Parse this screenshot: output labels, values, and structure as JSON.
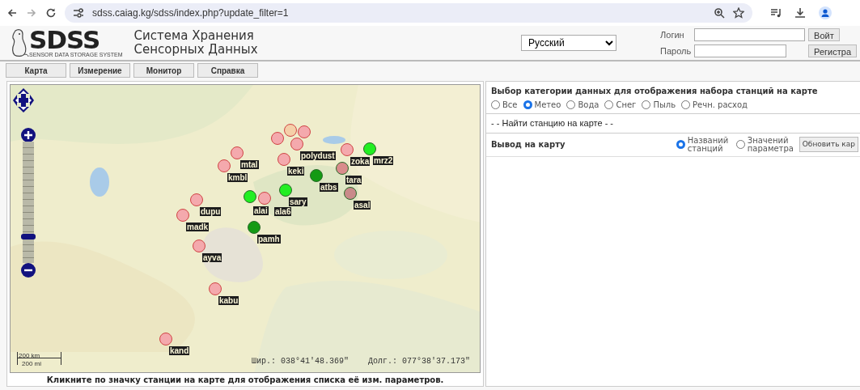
{
  "browser": {
    "url": "sdss.caiag.kg/sdss/index.php?update_filter=1"
  },
  "header": {
    "logo": "SDSS",
    "logo_subtitle": "SENSOR DATA STORAGE SYSTEM",
    "title_lines": [
      "Система Хранения",
      "Сенсорных Данных"
    ],
    "language": "Русский",
    "login_label": "Логин",
    "password_label": "Пароль",
    "login_button": "Войт",
    "register_button": "Регистра"
  },
  "menu": [
    "Карта",
    "Измерение",
    "Монитор",
    "Справка"
  ],
  "map": {
    "zoom_slider": {
      "level": 0.2
    },
    "stations": [
      {
        "color": "#f5cfa8"
      },
      {
        "color": "#f4a9ad"
      },
      {
        "color": "#f4a9ad"
      },
      {
        "label": "polydust",
        "color": "#f4a9ad"
      },
      {
        "label": "mtal",
        "color": "#f4a9ad"
      },
      {
        "label": "kmbl",
        "color": "#f4a9ad"
      },
      {
        "label": "keki",
        "color": "#f4a9ad"
      },
      {
        "label": "zoka",
        "color": "#f4a9ad"
      },
      {
        "label": "tara",
        "color": "#d98c8c"
      },
      {
        "label": "mrz2",
        "color": "#22ee22"
      },
      {
        "label": "atbs",
        "color": "#149a14"
      },
      {
        "label": "asal",
        "color": "#c98a8a"
      },
      {
        "label": "dupu",
        "color": "#f4a9ad"
      },
      {
        "label": "madk",
        "color": "#f4a9ad"
      },
      {
        "label": "alai",
        "color": "#22ee22"
      },
      {
        "label": "ala6",
        "color": "#f4a9ad"
      },
      {
        "label": "sary",
        "color": "#22ee22"
      },
      {
        "label": "pamh",
        "color": "#149a14"
      },
      {
        "label": "ayva",
        "color": "#f4a9ad"
      },
      {
        "label": "kabu",
        "color": "#f4a9ad"
      },
      {
        "label": "kand",
        "color": "#f4a9ad"
      }
    ],
    "scale": [
      "200 km",
      "200 mi"
    ],
    "latitude": "Шир.: 038°41'48.369\"",
    "longitude": "Долг.: 077°38'37.173\"",
    "caption": "Кликните по значку станции на карте для отображения списка её изм. параметров."
  },
  "filter": {
    "title": "Выбор категории данных для отображения набора станций на карте",
    "categories": [
      {
        "label": "Все",
        "selected": false
      },
      {
        "label": "Метео",
        "selected": true
      },
      {
        "label": "Вода",
        "selected": false
      },
      {
        "label": "Снег",
        "selected": false
      },
      {
        "label": "Пыль",
        "selected": false
      },
      {
        "label": "Речн. расход",
        "selected": false
      }
    ],
    "station_search": "- - Найти станцию на карте - -",
    "output_label": "Вывод на карту",
    "output_options": [
      {
        "label": "Названий станций",
        "selected": true
      },
      {
        "label": "Значений параметра",
        "selected": false
      }
    ],
    "update_button": "Обновить кар"
  }
}
